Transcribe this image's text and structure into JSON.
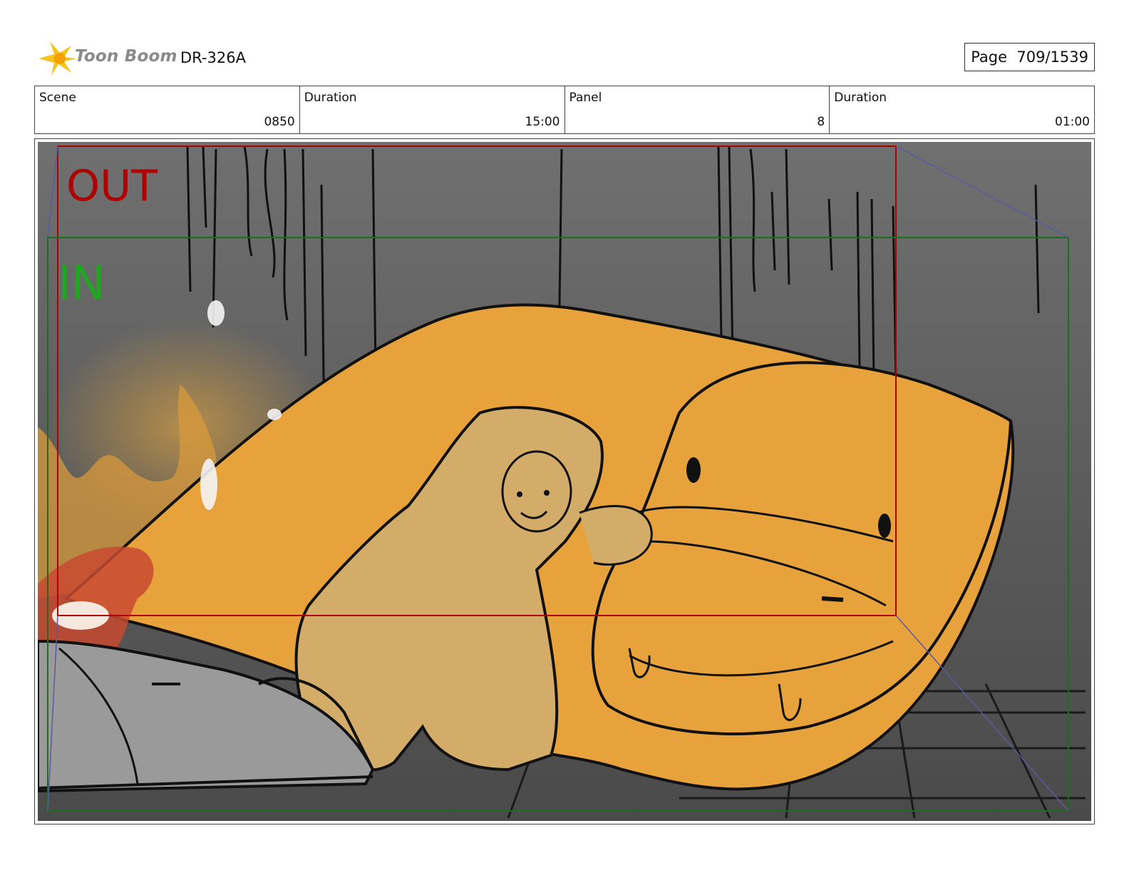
{
  "header": {
    "logo_text": "Toon Boom",
    "doc_code": "DR-326A",
    "page_label": "Page",
    "page_number": "709/1539"
  },
  "info": {
    "scene_label": "Scene",
    "scene_value": "0850",
    "scene_duration_label": "Duration",
    "scene_duration_value": "15:00",
    "panel_label": "Panel",
    "panel_value": "8",
    "panel_duration_label": "Duration",
    "panel_duration_value": "01:00"
  },
  "panel": {
    "out_label": "OUT",
    "in_label": "IN",
    "out_color": "#b00000",
    "in_color": "#1fa81f",
    "creature_color": "#e8a23c",
    "character_color": "#d4ac6a",
    "background_color": "#6a6a6a"
  }
}
